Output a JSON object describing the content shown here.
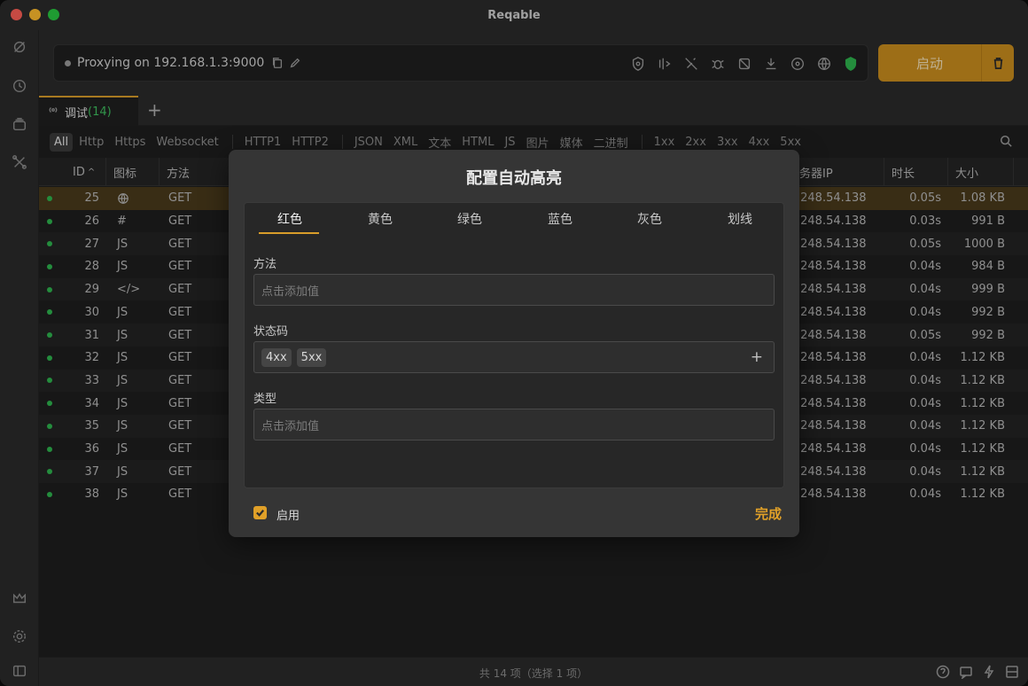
{
  "app": {
    "title": "Reqable"
  },
  "proxy": {
    "status": "Proxying on 192.168.1.3:9000",
    "start_label": "启动"
  },
  "tabs": [
    {
      "label": "调试",
      "count": "(14)"
    }
  ],
  "filters": {
    "groups": [
      [
        "All",
        "Http",
        "Https",
        "Websocket"
      ],
      [
        "HTTP1",
        "HTTP2"
      ],
      [
        "JSON",
        "XML",
        "文本",
        "HTML",
        "JS",
        "图片",
        "媒体",
        "二进制"
      ],
      [
        "1xx",
        "2xx",
        "3xx",
        "4xx",
        "5xx"
      ]
    ]
  },
  "table": {
    "columns": {
      "id": "ID",
      "icon": "图标",
      "method": "方法",
      "server_ip": "务器IP",
      "duration": "时长",
      "size": "大小"
    },
    "rows": [
      {
        "id": "25",
        "icon": "globe-icon",
        "method": "GET",
        "ip": ".248.54.138",
        "dur": "0.05s",
        "size": "1.08 KB",
        "selected": true
      },
      {
        "id": "26",
        "icon": "#",
        "method": "GET",
        "ip": ".248.54.138",
        "dur": "0.03s",
        "size": "991 B"
      },
      {
        "id": "27",
        "icon": "JS",
        "method": "GET",
        "ip": ".248.54.138",
        "dur": "0.05s",
        "size": "1000 B"
      },
      {
        "id": "28",
        "icon": "JS",
        "method": "GET",
        "ip": ".248.54.138",
        "dur": "0.04s",
        "size": "984 B"
      },
      {
        "id": "29",
        "icon": "</>",
        "method": "GET",
        "ip": ".248.54.138",
        "dur": "0.04s",
        "size": "999 B"
      },
      {
        "id": "30",
        "icon": "JS",
        "method": "GET",
        "ip": ".248.54.138",
        "dur": "0.04s",
        "size": "992 B"
      },
      {
        "id": "31",
        "icon": "JS",
        "method": "GET",
        "ip": ".248.54.138",
        "dur": "0.05s",
        "size": "992 B"
      },
      {
        "id": "32",
        "icon": "JS",
        "method": "GET",
        "ip": ".248.54.138",
        "dur": "0.04s",
        "size": "1.12 KB"
      },
      {
        "id": "33",
        "icon": "JS",
        "method": "GET",
        "ip": ".248.54.138",
        "dur": "0.04s",
        "size": "1.12 KB"
      },
      {
        "id": "34",
        "icon": "JS",
        "method": "GET",
        "ip": ".248.54.138",
        "dur": "0.04s",
        "size": "1.12 KB"
      },
      {
        "id": "35",
        "icon": "JS",
        "method": "GET",
        "ip": ".248.54.138",
        "dur": "0.04s",
        "size": "1.12 KB"
      },
      {
        "id": "36",
        "icon": "JS",
        "method": "GET",
        "ip": ".248.54.138",
        "dur": "0.04s",
        "size": "1.12 KB"
      },
      {
        "id": "37",
        "icon": "JS",
        "method": "GET",
        "ip": ".248.54.138",
        "dur": "0.04s",
        "size": "1.12 KB"
      },
      {
        "id": "38",
        "icon": "JS",
        "method": "GET",
        "ip": ".248.54.138",
        "dur": "0.04s",
        "size": "1.12 KB"
      }
    ]
  },
  "status_bar": {
    "text": "共 14 项（选择 1 项）"
  },
  "dialog": {
    "title": "配置自动高亮",
    "color_tabs": [
      "红色",
      "黄色",
      "绿色",
      "蓝色",
      "灰色",
      "划线"
    ],
    "active_tab": "红色",
    "method": {
      "label": "方法",
      "placeholder": "点击添加值"
    },
    "status_code": {
      "label": "状态码",
      "chips": [
        "4xx",
        "5xx"
      ],
      "add": "+"
    },
    "type": {
      "label": "类型",
      "placeholder": "点击添加值"
    },
    "enable_label": "启用",
    "enabled": true,
    "done_label": "完成"
  },
  "colors": {
    "accent": "#d89d2a",
    "start_button": "#c98d1e",
    "status_green": "#2fb54f",
    "selected_row": "#4a3a1c"
  }
}
